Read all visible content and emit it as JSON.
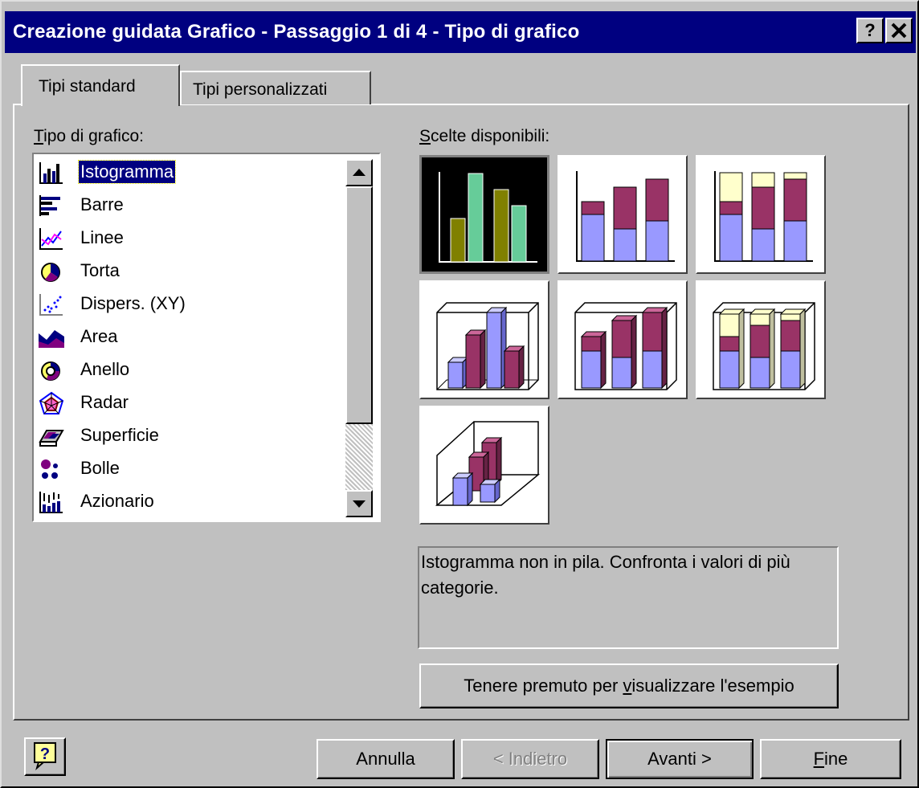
{
  "window": {
    "title": "Creazione guidata Grafico - Passaggio 1 di 4 - Tipo di grafico",
    "help_glyph": "?",
    "close_glyph": "✕"
  },
  "tabs": [
    {
      "label": "Tipi standard",
      "active": true
    },
    {
      "label": "Tipi personalizzati",
      "active": false
    }
  ],
  "chart_type": {
    "label_mnemonic": "T",
    "label_rest": "ipo di grafico:",
    "selected": "Istogramma",
    "items": [
      {
        "label": "Istogramma",
        "icon": "column-chart-icon"
      },
      {
        "label": "Barre",
        "icon": "bar-chart-icon"
      },
      {
        "label": "Linee",
        "icon": "line-chart-icon"
      },
      {
        "label": "Torta",
        "icon": "pie-chart-icon"
      },
      {
        "label": "Dispers. (XY)",
        "icon": "scatter-chart-icon"
      },
      {
        "label": "Area",
        "icon": "area-chart-icon"
      },
      {
        "label": "Anello",
        "icon": "doughnut-chart-icon"
      },
      {
        "label": "Radar",
        "icon": "radar-chart-icon"
      },
      {
        "label": "Superficie",
        "icon": "surface-chart-icon"
      },
      {
        "label": "Bolle",
        "icon": "bubble-chart-icon"
      },
      {
        "label": "Azionario",
        "icon": "stock-chart-icon"
      }
    ]
  },
  "subtypes": {
    "label_mnemonic": "S",
    "label_rest": "celte disponibili:",
    "selected_index": 0,
    "description": "Istogramma non in pila. Confronta i valori di più categorie."
  },
  "preview_button": {
    "before": "Tenere premuto per ",
    "mnemonic": "v",
    "after": "isualizzare l'esempio"
  },
  "footer": {
    "help_icon": "?",
    "cancel": "Annulla",
    "back": "< Indietro",
    "next": "Avanti >",
    "finish_mnemonic": "F",
    "finish_rest": "ine"
  },
  "colors": {
    "titlebar": "#000080",
    "selection": "#000080",
    "face": "#c0c0c0",
    "bar_olive": "#808000",
    "bar_mint": "#66cc99",
    "bar_lavender": "#9999ff",
    "bar_plum": "#993366",
    "bar_ivory": "#ffffcc"
  }
}
